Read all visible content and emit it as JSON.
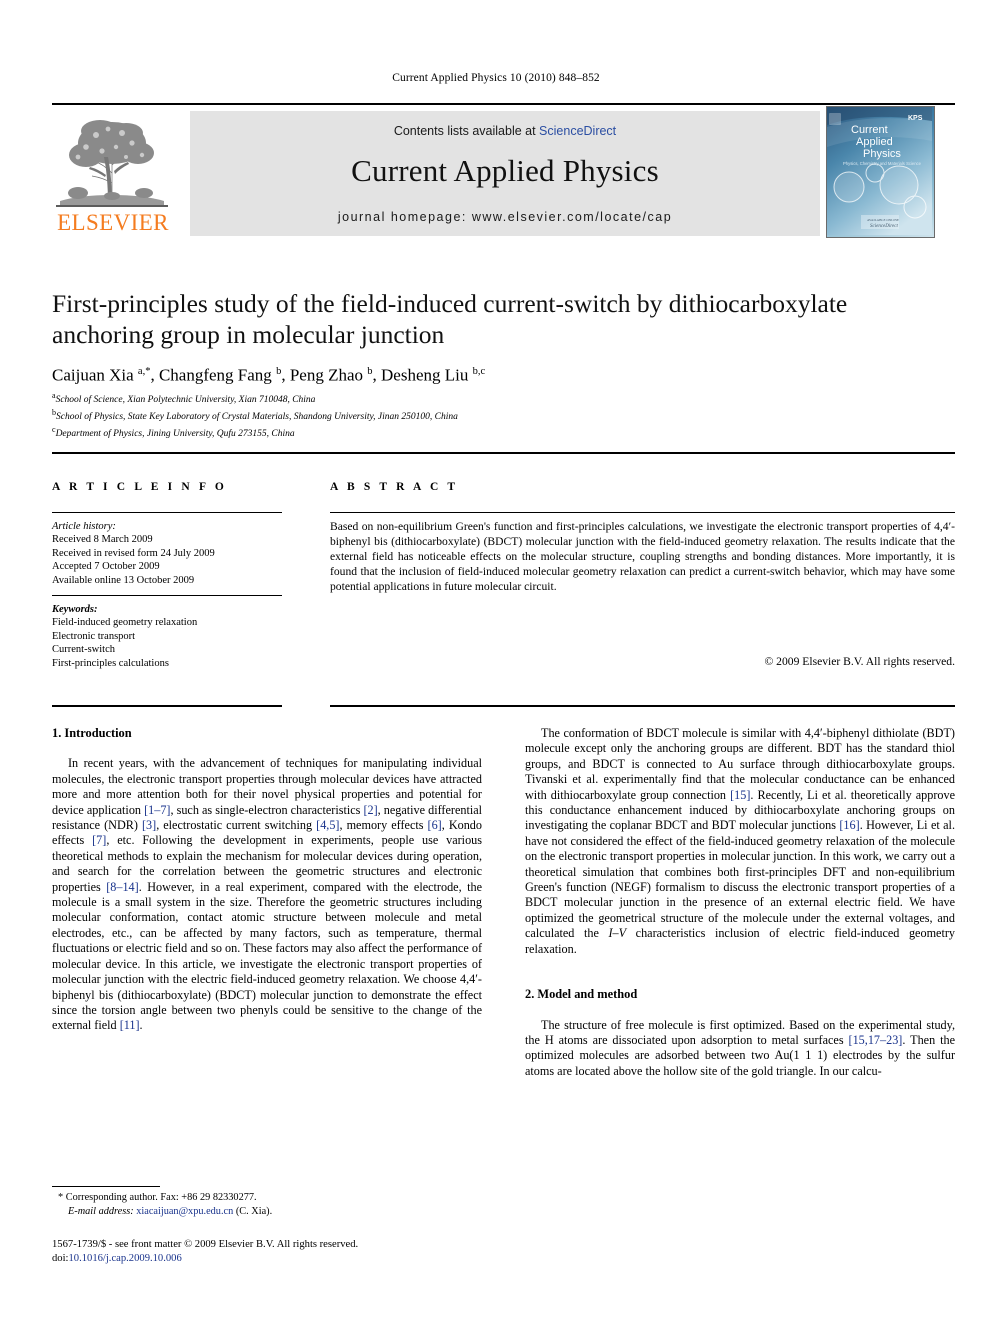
{
  "running_head": "Current Applied Physics 10 (2010) 848–852",
  "masthead": {
    "contents_prefix": "Contents lists available at ",
    "sciencedirect": "ScienceDirect",
    "journal_title": "Current Applied Physics",
    "homepage": "journal homepage: www.elsevier.com/locate/cap",
    "publisher_logo_text": "ELSEVIER",
    "cover": {
      "line1": "Current",
      "line2": "Applied",
      "line3": "Physics",
      "subtitle": "Physics, Chemistry and Materials Science",
      "society_badge": "KPS"
    },
    "accent_orange": "#F47C20",
    "link_blue": "#2b4ea2",
    "banner_gray": "#e3e3e3"
  },
  "article": {
    "title": "First-principles study of the field-induced current-switch by dithiocarboxylate anchoring group in molecular junction",
    "authors_html": "Caijuan Xia <sup>a,*</sup>, Changfeng Fang <sup>b</sup>, Peng Zhao <sup>b</sup>, Desheng Liu <sup>b,c</sup>",
    "affiliations": [
      {
        "marker": "a",
        "text": "School of Science, Xian Polytechnic University, Xian 710048, China"
      },
      {
        "marker": "b",
        "text": "School of Physics, State Key Laboratory of Crystal Materials, Shandong University, Jinan 250100, China"
      },
      {
        "marker": "c",
        "text": "Department of Physics, Jining University, Qufu 273155, China"
      }
    ]
  },
  "article_info": {
    "label": "A R T I C L E  I N F O",
    "history_title": "Article history:",
    "history": [
      "Received 8 March 2009",
      "Received in revised form 24 July 2009",
      "Accepted 7 October 2009",
      "Available online 13 October 2009"
    ],
    "keywords_title": "Keywords:",
    "keywords": [
      "Field-induced geometry relaxation",
      "Electronic transport",
      "Current-switch",
      "First-principles calculations"
    ]
  },
  "abstract": {
    "label": "A B S T R A C T",
    "text": "Based on non-equilibrium Green's function and first-principles calculations, we investigate the electronic transport properties of 4,4′-biphenyl bis (dithiocarboxylate) (BDCT) molecular junction with the field-induced geometry relaxation. The results indicate that the external field has noticeable effects on the molecular structure, coupling strengths and bonding distances. More importantly, it is found that the inclusion of field-induced molecular geometry relaxation can predict a current-switch behavior, which may have some potential applications in future molecular circuit.",
    "copyright": "© 2009 Elsevier B.V. All rights reserved."
  },
  "sections": {
    "introduction_heading": "1. Introduction",
    "model_heading": "2. Model and method"
  },
  "body": {
    "intro_p1_html": "In recent years, with the advancement of techniques for manipulating individual molecules, the electronic transport properties through molecular devices have attracted more and more attention both for their novel physical properties and potential for device application <span class=\"cite\">[1&ndash;7]</span>, such as single-electron characteristics <span class=\"cite\">[2]</span>, negative differential resistance (NDR) <span class=\"cite\">[3]</span>, electrostatic current switching <span class=\"cite\">[4,5]</span>, memory effects <span class=\"cite\">[6]</span>, Kondo effects <span class=\"cite\">[7]</span>, etc. Following the development in experiments, people use various theoretical methods to explain the mechanism for molecular devices during operation, and search for the correlation between the geometric structures and electronic properties <span class=\"cite\">[8&ndash;14]</span>. However, in a real experiment, compared with the electrode, the molecule is a small system in the size. Therefore the geometric structures including molecular conformation, contact atomic structure between molecule and metal electrodes, etc., can be affected by many factors, such as temperature, thermal fluctuations or electric field and so on. These factors may also affect the performance of molecular device. In this article, we investigate the electronic transport properties of molecular junction with the electric field-induced geometry relaxation. We choose 4,4&prime;-biphenyl bis (dithiocarboxylate) (BDCT) molecular junction to demonstrate the effect since the torsion angle between two phenyls could be sensitive to the change of the external field <span class=\"cite\">[11]</span>.",
    "right_p1_html": "The conformation of BDCT molecule is similar with 4,4&prime;-biphenyl dithiolate (BDT) molecule except only the anchoring groups are different. BDT has the standard thiol groups, and BDCT is connected to Au surface through dithiocarboxylate groups. Tivanski et al. experimentally find that the molecular conductance can be enhanced with dithiocarboxylate group connection <span class=\"cite\">[15]</span>. Recently, Li et al. theoretically approve this conductance enhancement induced by dithiocarboxylate anchoring groups on investigating the coplanar BDCT and BDT molecular junctions <span class=\"cite\">[16]</span>. However, Li et al. have not considered the effect of the field-induced geometry relaxation of the molecule on the electronic transport properties in molecular junction. In this work, we carry out a theoretical simulation that combines both first-principles DFT and non-equilibrium Green's function (NEGF) formalism to discuss the electronic transport properties of a BDCT molecular junction in the presence of an external electric field. We have optimized the geometrical structure of the molecule under the external voltages, and calculated the <span class=\"ital\">I&ndash;V</span> characteristics inclusion of electric field-induced geometry relaxation.",
    "right_p2_html": "The structure of free molecule is first optimized. Based on the experimental study, the H atoms are dissociated upon adsorption to metal surfaces <span class=\"cite\">[15,17&ndash;23]</span>. Then the optimized molecules are adsorbed between two Au(1 1 1) electrodes by the sulfur atoms are located above the hollow site of the gold triangle. In our calcu-"
  },
  "footnote": {
    "marker": "*",
    "corresponding": "Corresponding author. Fax: +86 29 82330277.",
    "email_label": "E-mail address:",
    "email": "xiacaijuan@xpu.edu.cn",
    "email_suffix": "(C. Xia).",
    "issn_line": "1567-1739/$ - see front matter © 2009 Elsevier B.V. All rights reserved.",
    "doi_label": "doi:",
    "doi": "10.1016/j.cap.2009.10.006"
  }
}
